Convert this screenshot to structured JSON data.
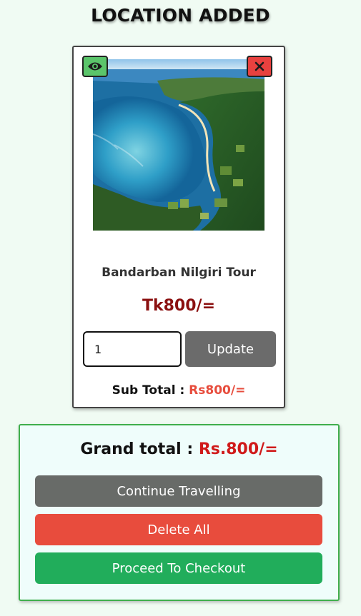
{
  "heading": "LOCATION ADDED",
  "card": {
    "photo_alt": "aerial coastline photo",
    "title": "Bandarban Nilgiri Tour",
    "price": "Tk800/=",
    "quantity": "1",
    "update_label": "Update",
    "subtotal_label": "Sub Total :",
    "subtotal_value": "Rs800/=",
    "view_icon": "eye-icon",
    "remove_icon": "close-icon"
  },
  "summary": {
    "grand_label": "Grand total :",
    "grand_value": "Rs.800/=",
    "continue_label": "Continue Travelling",
    "delete_label": "Delete All",
    "checkout_label": "Proceed To Checkout"
  },
  "colors": {
    "background": "#f0fbf3",
    "price": "#8b1010",
    "subtotal_value": "#e74c3c",
    "grand_value": "#d01a1a",
    "update_button": "#6b6b6b",
    "continue_button": "#686b68",
    "delete_button": "#e84c3d",
    "checkout_button": "#21ad5b",
    "summary_border": "#3fae4c",
    "eye_button": "#5bc56b",
    "close_button": "#e8413f"
  }
}
